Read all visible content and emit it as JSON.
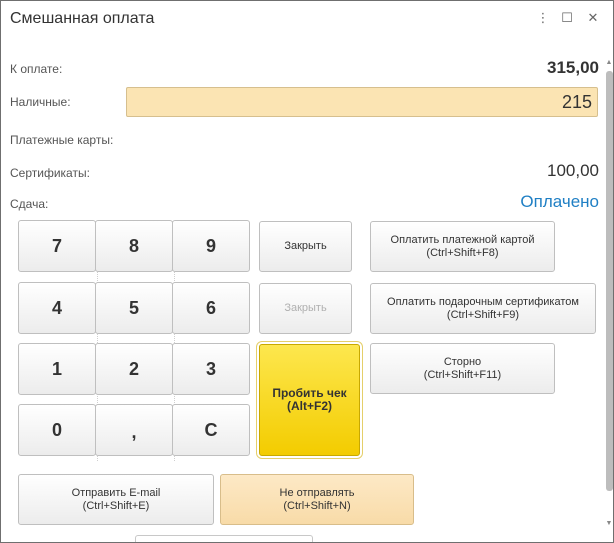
{
  "window": {
    "title": "Смешанная оплата",
    "controls": {
      "more": "⋮",
      "maximize": "☐",
      "close": "✕"
    }
  },
  "fields": {
    "to_pay_label": "К оплате:",
    "to_pay_value": "315,00",
    "cash_label": "Наличные:",
    "cash_value": "215",
    "cards_label": "Платежные карты:",
    "certificates_label": "Сертификаты:",
    "certificates_value": "100,00",
    "change_label": "Сдача:",
    "change_status": "Оплачено"
  },
  "keypad": {
    "k7": "7",
    "k8": "8",
    "k9": "9",
    "k4": "4",
    "k5": "5",
    "k6": "6",
    "k1": "1",
    "k2": "2",
    "k3": "3",
    "k0": "0",
    "comma": ",",
    "clear": "C"
  },
  "buttons": {
    "close1": "Закрыть",
    "close2": "Закрыть",
    "pay_card_line1": "Оплатить платежной картой",
    "pay_card_line2": "(Ctrl+Shift+F8)",
    "pay_cert_line1": "Оплатить подарочным сертификатом",
    "pay_cert_line2": "(Ctrl+Shift+F9)",
    "storno_line1": "Сторно",
    "storno_line2": "(Ctrl+Shift+F11)",
    "print_receipt_line1": "Пробить чек",
    "print_receipt_line2": "(Alt+F2)",
    "send_email_line1": "Отправить E-mail",
    "send_email_line2": "(Ctrl+Shift+E)",
    "dont_send_line1": "Не отправлять",
    "dont_send_line2": "(Ctrl+Shift+N)"
  },
  "colors": {
    "accent_status": "#1f7fc4",
    "input_bg": "#fbe4b3",
    "primary_button": "#f5d000",
    "warm_button": "#fae0b2"
  }
}
